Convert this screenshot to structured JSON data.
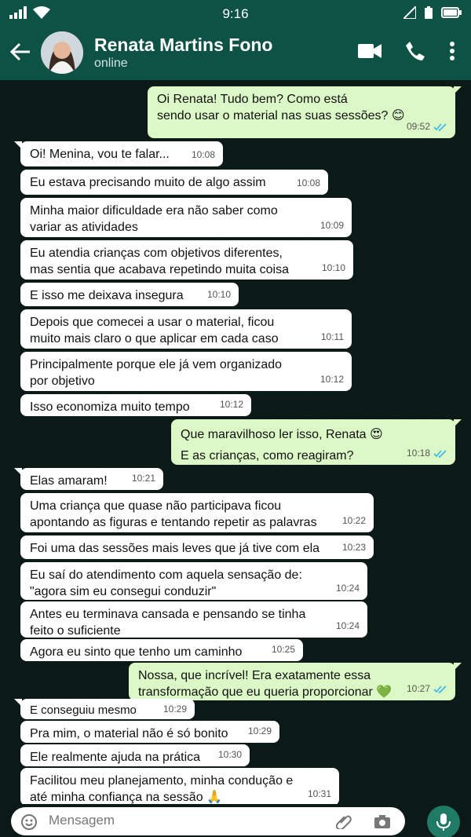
{
  "status_bar": {
    "time": "9:16"
  },
  "header": {
    "name": "Renata Martins Fono",
    "status": "online"
  },
  "messages": [
    {
      "dir": "out",
      "text": "Oi Renata! Tudo bem? Como está\nsendo usar o material nas suas sessões? 😊",
      "time": "09:52",
      "read": true
    },
    {
      "dir": "in",
      "text": "Oi! Menina, vou te falar...",
      "time": "10:08"
    },
    {
      "dir": "in",
      "text": "Eu estava precisando muito de algo assim",
      "time": "10:08"
    },
    {
      "dir": "in",
      "text": "Minha maior dificuldade era não saber como\nvariar as atividades",
      "time": "10:09"
    },
    {
      "dir": "in",
      "text": "Eu atendia crianças com objetivos diferentes,\nmas sentia que acabava repetindo muita coisa",
      "time": "10:10"
    },
    {
      "dir": "in",
      "text": "E isso me deixava insegura",
      "time": "10:10"
    },
    {
      "dir": "in",
      "text": "Depois que comecei a usar o material, ficou\nmuito mais claro o que aplicar em cada caso",
      "time": "10:11"
    },
    {
      "dir": "in",
      "text": "Principalmente porque ele já vem organizado\npor objetivo",
      "time": "10:12"
    },
    {
      "dir": "in",
      "text": "Isso economiza muito tempo",
      "time": "10:12"
    },
    {
      "dir": "out",
      "text": "Que maravilhoso ler isso, Renata 😍\nE as crianças, como reagiram?",
      "time": "10:18",
      "read": true
    },
    {
      "dir": "in",
      "text": "Elas amaram!",
      "time": "10:21"
    },
    {
      "dir": "in",
      "text": "Uma criança que quase não participava ficou\napontando as figuras e tentando repetir as palavras",
      "time": "10:22"
    },
    {
      "dir": "in",
      "text": "Foi uma das sessões mais leves que já tive com ela",
      "time": "10:23"
    },
    {
      "dir": "in",
      "text": "Eu saí do atendimento com aquela sensação de:\n\"agora sim eu consegui conduzir\"",
      "time": "10:24"
    },
    {
      "dir": "in",
      "text": "Antes eu terminava cansada e pensando se tinha\nfeito o suficiente",
      "time": "10:24"
    },
    {
      "dir": "in",
      "text": "Agora eu sinto que tenho um caminho",
      "time": "10:25"
    },
    {
      "dir": "out",
      "text": "Nossa, que incrível! Era exatamente essa\ntransformação que eu queria proporcionar 💚",
      "time": "10:27",
      "read": true
    },
    {
      "dir": "in",
      "text": "E conseguiu mesmo",
      "time": "10:29"
    },
    {
      "dir": "in",
      "text": "Pra mim, o material não é só bonito",
      "time": "10:29"
    },
    {
      "dir": "in",
      "text": "Ele realmente ajuda na prática",
      "time": "10:30"
    },
    {
      "dir": "in",
      "text": "Facilitou meu planejamento, minha condução e\naté minha confiança na sessão 🙏",
      "time": "10:31"
    }
  ],
  "composer": {
    "placeholder": "Mensagem"
  },
  "colors": {
    "header": "#0e5246",
    "outgoing": "#dcf8c6",
    "incoming": "#ffffff",
    "tick_read": "#34b7f1"
  }
}
